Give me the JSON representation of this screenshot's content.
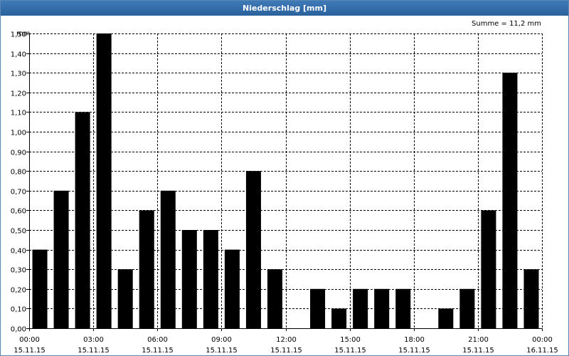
{
  "window": {
    "title": "Niederschlag [mm]"
  },
  "chart_data": {
    "type": "bar",
    "title": "Niederschlag [mm]",
    "ylabel": "mm",
    "annotation": "Summe = 11,2 mm",
    "ylim": [
      0,
      1.5
    ],
    "grid": true,
    "bar_color": "#000000",
    "y_ticks": [
      "0,00",
      "0,10",
      "0,20",
      "0,30",
      "0,40",
      "0,50",
      "0,60",
      "0,70",
      "0,80",
      "0,90",
      "1,00",
      "1,10",
      "1,20",
      "1,30",
      "1,40",
      "1,50"
    ],
    "x_ticks": [
      {
        "time": "00:00",
        "date": "15.11.15"
      },
      {
        "time": "03:00",
        "date": "15.11.15"
      },
      {
        "time": "06:00",
        "date": "15.11.15"
      },
      {
        "time": "09:00",
        "date": "15.11.15"
      },
      {
        "time": "12:00",
        "date": "15.11.15"
      },
      {
        "time": "15:00",
        "date": "15.11.15"
      },
      {
        "time": "18:00",
        "date": "15.11.15"
      },
      {
        "time": "21:00",
        "date": "15.11.15"
      },
      {
        "time": "00:00",
        "date": "16.11.15"
      }
    ],
    "series": [
      {
        "values": [
          0.4,
          0.7,
          1.1,
          1.5,
          0.3,
          0.6,
          0.7,
          0.5,
          0.5,
          0.4,
          0.8,
          0.3,
          0.0,
          0.2,
          0.1,
          0.2,
          0.2,
          0.2,
          0.0,
          0.1,
          0.2,
          0.6,
          1.3,
          0.3
        ]
      }
    ]
  }
}
